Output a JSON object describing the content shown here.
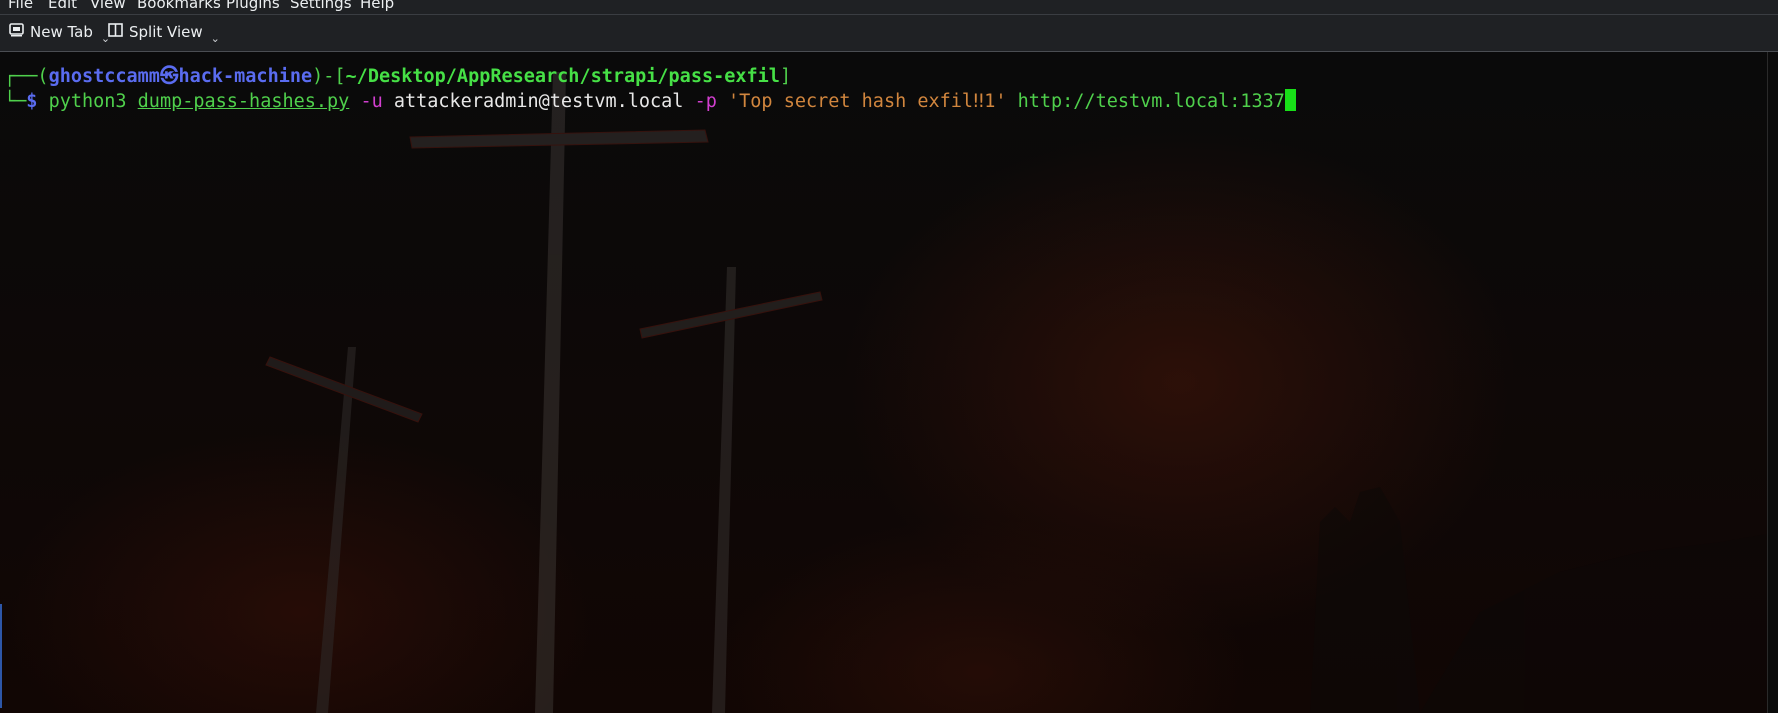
{
  "menubar": {
    "items": [
      "File",
      "Edit",
      "View",
      "Bookmarks",
      "Plugins",
      "Settings",
      "Help"
    ]
  },
  "toolbar": {
    "new_tab_label": "New Tab",
    "split_view_label": "Split View",
    "new_tab_icon": "terminal-tab-icon",
    "split_view_icon": "split-view-icon"
  },
  "terminal": {
    "prompt": {
      "open_corner": "┌──(",
      "user": "ghostccamm",
      "at_symbol": "㉿",
      "host": "hack-machine",
      "mid": ")-[",
      "cwd": "~/Desktop/AppResearch/strapi/pass-exfil",
      "close": "]",
      "second_corner": "└─",
      "dollar": "$"
    },
    "command": {
      "program": "python3",
      "script": "dump-pass-hashes.py",
      "flag_u": "-u",
      "user_value": "attackeradmin@testvm.local",
      "flag_p": "-p",
      "password_value": "'Top secret hash exfil‼1'",
      "url": "http://testvm.local:1337"
    },
    "colors": {
      "prompt_frame": "#4fd04c",
      "user_host": "#5a6cf0",
      "cwd": "#46e046",
      "flag": "#d23fd0",
      "string": "#d1863e",
      "cursor": "#18e018"
    }
  }
}
